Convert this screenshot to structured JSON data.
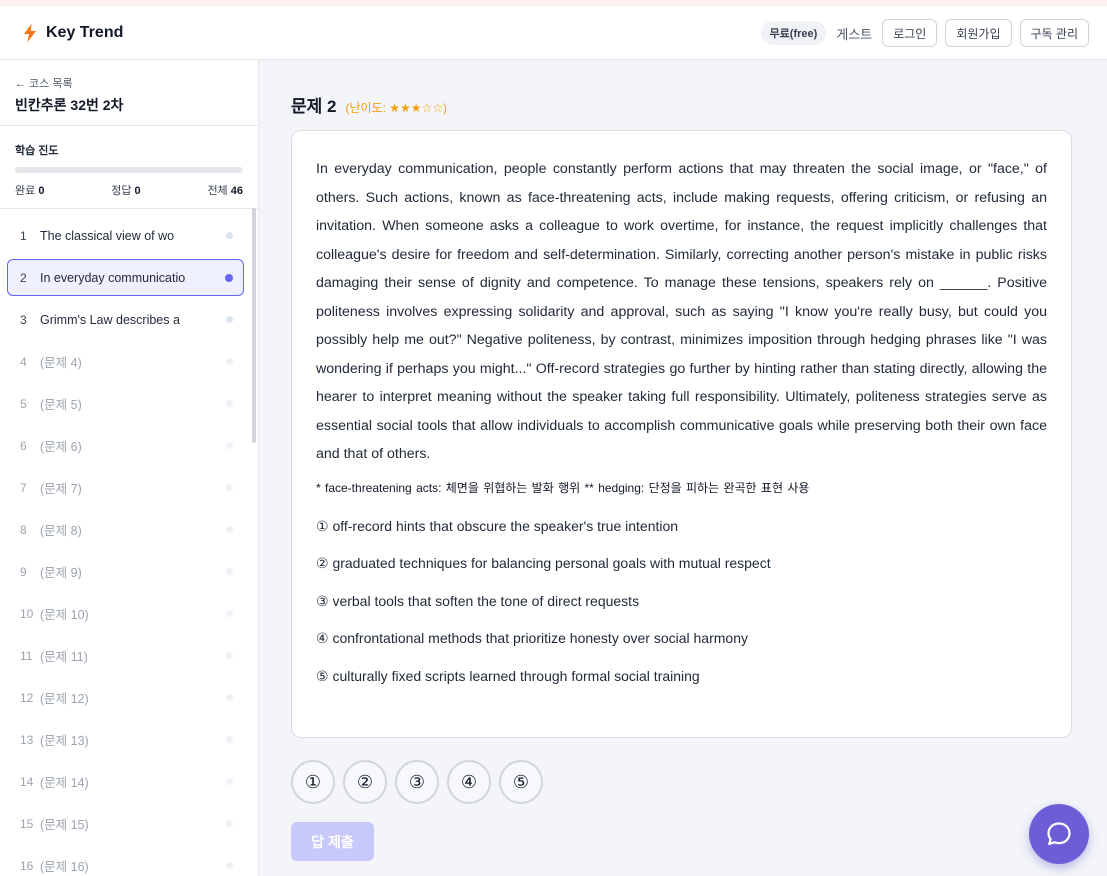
{
  "header": {
    "app_name": "Key Trend",
    "plan_badge": "무료(free)",
    "user_label": "게스트",
    "login_label": "로그인",
    "signup_label": "회원가입",
    "subscription_label": "구독 관리"
  },
  "sidebar": {
    "back_label": "← 코스 목록",
    "course_title": "빈칸추론 32번 2차",
    "progress": {
      "label": "학습 진도",
      "done_label": "완료",
      "done": "0",
      "correct_label": "정답",
      "correct": "0",
      "total_label": "전체",
      "total": "46",
      "fraction": 0
    },
    "items": [
      {
        "num": "1",
        "label": "The classical view of wo"
      },
      {
        "num": "2",
        "label": "In everyday communicatio"
      },
      {
        "num": "3",
        "label": "Grimm's Law describes a"
      },
      {
        "num": "4",
        "label": "(문제 4)"
      },
      {
        "num": "5",
        "label": "(문제 5)"
      },
      {
        "num": "6",
        "label": "(문제 6)"
      },
      {
        "num": "7",
        "label": "(문제 7)"
      },
      {
        "num": "8",
        "label": "(문제 8)"
      },
      {
        "num": "9",
        "label": "(문제 9)"
      },
      {
        "num": "10",
        "label": "(문제 10)"
      },
      {
        "num": "11",
        "label": "(문제 11)"
      },
      {
        "num": "12",
        "label": "(문제 12)"
      },
      {
        "num": "13",
        "label": "(문제 13)"
      },
      {
        "num": "14",
        "label": "(문제 14)"
      },
      {
        "num": "15",
        "label": "(문제 15)"
      },
      {
        "num": "16",
        "label": "(문제 16)"
      }
    ]
  },
  "question": {
    "title": "문제 2",
    "difficulty": "(난이도: ★★★☆☆)",
    "passage": "In everyday communication, people constantly perform actions that may threaten the social image, or \"face,\" of others. Such actions, known as face-threatening acts, include making requests, offering criticism, or refusing an invitation. When someone asks a colleague to work overtime, for instance, the request implicitly challenges that colleague's desire for freedom and self-determination. Similarly, correcting another person's mistake in public risks damaging their sense of dignity and competence. To manage these tensions, speakers rely on ______. Positive politeness involves expressing solidarity and approval, such as saying \"I know you're really busy, but could you possibly help me out?\" Negative politeness, by contrast, minimizes imposition through hedging phrases like \"I was wondering if perhaps you might...\" Off-record strategies go further by hinting rather than stating directly, allowing the hearer to interpret meaning without the speaker taking full responsibility. Ultimately, politeness strategies serve as essential social tools that allow individuals to accomplish communicative goals while preserving both their own face and that of others.",
    "note": "* face-threatening acts: 체면을 위협하는 발화 행위   ** hedging: 단정을 피하는 완곡한 표현 사용",
    "options": [
      "① off-record hints that obscure the speaker's true intention",
      "② graduated techniques for balancing personal goals with mutual respect",
      "③ verbal tools that soften the tone of direct requests",
      "④ confrontational methods that prioritize honesty over social harmony",
      "⑤ culturally fixed scripts learned through formal social training"
    ],
    "choices": [
      "①",
      "②",
      "③",
      "④",
      "⑤"
    ],
    "submit_label": "답 제출"
  },
  "colors": {
    "accent": "#6366f1",
    "difficulty": "#f59e0b",
    "logo": "#f97316",
    "chat_button": "#6d5ed8"
  },
  "icons": {
    "logo": "bolt-icon",
    "chat": "chat-bubble-icon"
  }
}
